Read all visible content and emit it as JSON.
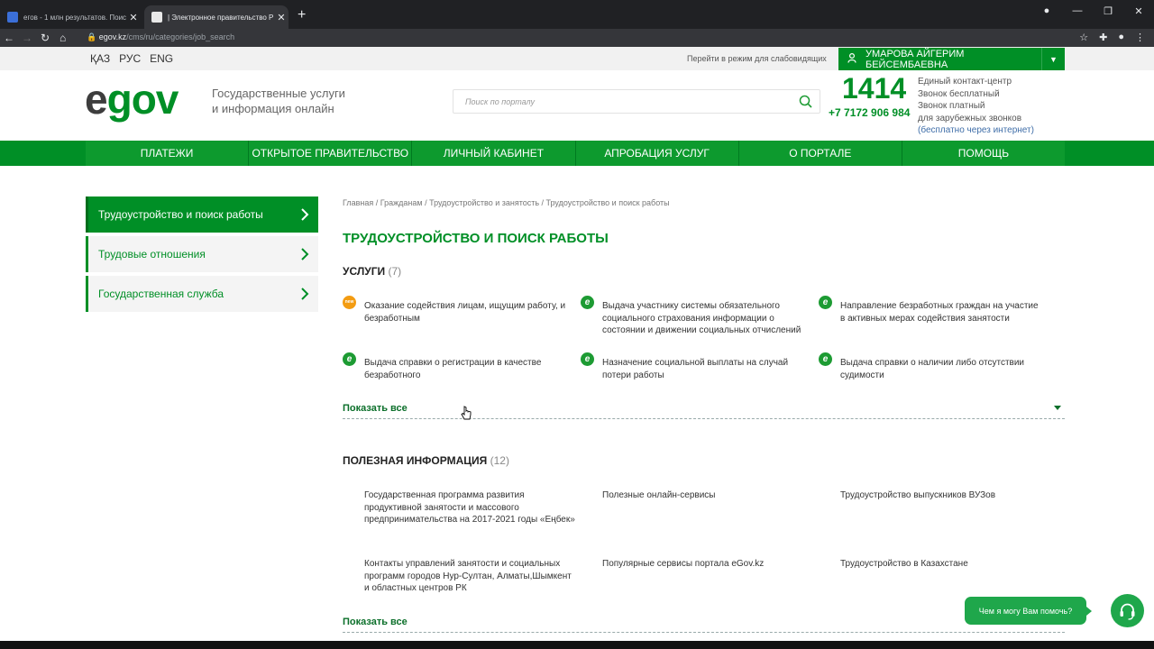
{
  "browser": {
    "tabs": [
      {
        "title": "егов - 1 млн результатов. Поис",
        "favicon_color": "#3b6fd8"
      },
      {
        "title": "| Электронное правительство Р",
        "favicon_color": "#e8e8e8"
      }
    ],
    "url_host": "egov.kz",
    "url_path": "/cms/ru/categories/job_search"
  },
  "top": {
    "languages": [
      "ҚАЗ",
      "РУС",
      "ENG"
    ],
    "accessibility": "Перейти в режим для слабовидящих",
    "user_name": "УМАРОВА АЙГЕРИМ БЕЙСЕМБАЕВНА"
  },
  "header": {
    "logo_e": "e",
    "logo_gov": "gov",
    "tagline_line1": "Государственные услуги",
    "tagline_line2": "и информация онлайн",
    "search_placeholder": "Поиск по порталу",
    "phone_short": "1414",
    "phone_long": "+7 7172 906 984",
    "contact_line1": "Единый контакт-центр",
    "contact_line2": "Звонок бесплатный",
    "contact_line3": "Звонок платный",
    "contact_line4": "для зарубежных звонков",
    "contact_line5": "(бесплатно через интернет)"
  },
  "nav": [
    "ПЛАТЕЖИ",
    "ОТКРЫТОЕ ПРАВИТЕЛЬСТВО",
    "ЛИЧНЫЙ КАБИНЕТ",
    "АПРОБАЦИЯ УСЛУГ",
    "О ПОРТАЛЕ",
    "ПОМОЩЬ"
  ],
  "sidebar": [
    {
      "label": "Трудоустройство и поиск работы",
      "active": true
    },
    {
      "label": "Трудовые отношения",
      "active": false
    },
    {
      "label": "Государственная служба",
      "active": false
    }
  ],
  "breadcrumb": "Главная  /  Гражданам  /  Трудоустройство и занятость  /  Трудоустройство и поиск работы",
  "page_title": "ТРУДОУСТРОЙСТВО И ПОИСК РАБОТЫ",
  "services": {
    "heading": "УСЛУГИ",
    "count": "(7)",
    "items": [
      {
        "badge": "new",
        "text": "Оказание содействия лицам, ищущим работу, и безработным"
      },
      {
        "badge": "e",
        "text": "Выдача участнику системы обязательного социального страхования информации о состоянии и движении социальных отчислений"
      },
      {
        "badge": "e",
        "text": "Направление безработных граждан на участие в активных мерах содействия занятости"
      },
      {
        "badge": "e",
        "text": "Выдача справки о регистрации в качестве безработного"
      },
      {
        "badge": "e",
        "text": "Назначение социальной выплаты на случай потери работы"
      },
      {
        "badge": "e",
        "text": "Выдача справки о наличии либо отсутствии судимости"
      }
    ],
    "show_all": "Показать все"
  },
  "useful_info": {
    "heading": "ПОЛЕЗНАЯ ИНФОРМАЦИЯ",
    "count": "(12)",
    "items": [
      "Государственная программа развития продуктивной занятости и массового предпринимательства на 2017-2021 годы «Еңбек»",
      "Полезные онлайн-сервисы",
      "Трудоустройство выпускников ВУЗов",
      "Контакты управлений занятости и социальных программ городов Нур-Султан, Алматы,Шымкент и областных центров РК",
      "Популярные сервисы портала eGov.kz",
      "Трудоустройство в Казахстане"
    ],
    "show_all": "Показать все"
  },
  "chat": {
    "label": "Чем я могу Вам помочь?"
  }
}
